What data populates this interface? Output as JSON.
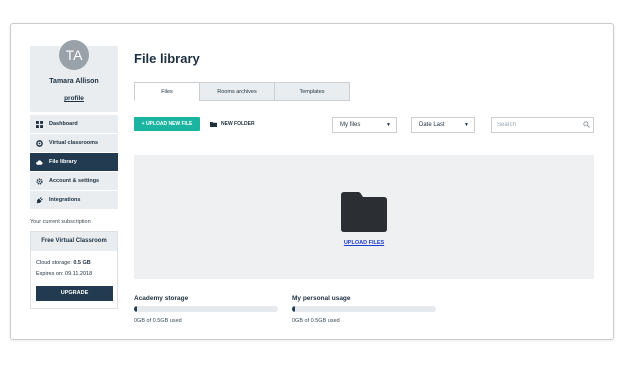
{
  "user": {
    "initials": "TA",
    "name": "Tamara Allison",
    "profile_link": "profile"
  },
  "sidebar": {
    "items": [
      {
        "label": "Dashboard",
        "icon": "grid-icon",
        "active": false
      },
      {
        "label": "Virtual classrooms",
        "icon": "gear-icon",
        "active": false
      },
      {
        "label": "File library",
        "icon": "cloud-icon",
        "active": true
      },
      {
        "label": "Account & settings",
        "icon": "settings-icon",
        "active": false
      },
      {
        "label": "Integrations",
        "icon": "plug-icon",
        "active": false
      }
    ]
  },
  "subscription": {
    "label": "Your current subscription",
    "plan": "Free Virtual Classroom",
    "storage_label": "Cloud storage:",
    "storage_value": "0.5 GB",
    "expires": "Expires on: 09.11.2018",
    "upgrade_label": "UPGRADE"
  },
  "main": {
    "title": "File library",
    "tabs": [
      {
        "label": "Files",
        "active": true
      },
      {
        "label": "Rooms archives",
        "active": false
      },
      {
        "label": "Templates",
        "active": false
      }
    ],
    "toolbar": {
      "upload_label": "+ UPLOAD NEW FILE",
      "new_folder_label": "NEW FOLDER",
      "filter_value": "My files",
      "sort_value": "Date Last",
      "search_placeholder": "Search"
    },
    "dropzone": {
      "upload_link": "UPLOAD FILES"
    },
    "usage": [
      {
        "label": "Academy storage",
        "text": "0GB of 0.5GB used",
        "fraction": 0.0
      },
      {
        "label": "My personal usage",
        "text": "0GB of 0.5GB used",
        "fraction": 0.0
      }
    ]
  },
  "colors": {
    "accent": "#1ab4a0",
    "navy": "#233b50",
    "link": "#1f3ccf"
  }
}
